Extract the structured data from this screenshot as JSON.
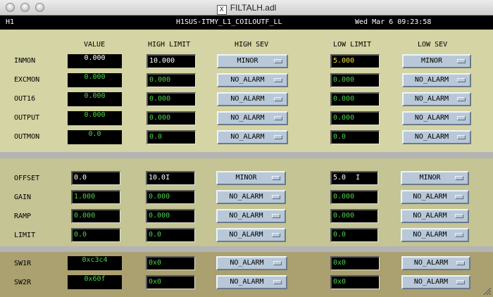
{
  "window": {
    "title": "FILTALH.adl",
    "x_icon": "X"
  },
  "header": {
    "site": "H1",
    "channel": "H1SUS-ITMY_L1_COILOUTF_LL",
    "datetime": "Wed Mar  6 09:23:58"
  },
  "columns": {
    "value": "VALUE",
    "high_limit": "HIGH LIMIT",
    "high_sev": "HIGH SEV",
    "low_limit": "LOW LIMIT",
    "low_sev": "LOW SEV"
  },
  "rows": {
    "inmon": {
      "label": "INMON",
      "value": "0.000",
      "high": "10.000",
      "high_sev": "MINOR",
      "low": "5.000",
      "low_sev": "MINOR"
    },
    "excmon": {
      "label": "EXCMON",
      "value": "0.000",
      "high": "0.000",
      "high_sev": "NO_ALARM",
      "low": "0.000",
      "low_sev": "NO_ALARM"
    },
    "out16": {
      "label": "OUT16",
      "value": "0.000",
      "high": "0.000",
      "high_sev": "NO_ALARM",
      "low": "0.000",
      "low_sev": "NO_ALARM"
    },
    "output": {
      "label": "OUTPUT",
      "value": "0.000",
      "high": "0.000",
      "high_sev": "NO_ALARM",
      "low": "0.000",
      "low_sev": "NO_ALARM"
    },
    "outmon": {
      "label": "OUTMON",
      "value": "0.0",
      "high": "0.0",
      "high_sev": "NO_ALARM",
      "low": "0.0",
      "low_sev": "NO_ALARM"
    },
    "offset": {
      "label": "OFFSET",
      "value": "0.0",
      "high": "10.0",
      "high_sev": "MINOR",
      "low": "5.0",
      "low_sev": "MINOR"
    },
    "gain": {
      "label": "GAIN",
      "value": "1.000",
      "high": "0.000",
      "high_sev": "NO_ALARM",
      "low": "0.000",
      "low_sev": "NO_ALARM"
    },
    "ramp": {
      "label": "RAMP",
      "value": "0.000",
      "high": "0.000",
      "high_sev": "NO_ALARM",
      "low": "0.000",
      "low_sev": "NO_ALARM"
    },
    "limit": {
      "label": "LIMIT",
      "value": "0.0",
      "high": "0.0",
      "high_sev": "NO_ALARM",
      "low": "0.0",
      "low_sev": "NO_ALARM"
    },
    "sw1r": {
      "label": "SW1R",
      "value": "0xc3c4",
      "high": "0x0",
      "high_sev": "NO_ALARM",
      "low": "0x0",
      "low_sev": "NO_ALARM"
    },
    "sw2r": {
      "label": "SW2R",
      "value": "0x60f",
      "high": "0x0",
      "high_sev": "NO_ALARM",
      "low": "0x0",
      "low_sev": "NO_ALARM"
    }
  },
  "colors": {
    "panel_top": "#d4d4a4",
    "panel_mid": "#c4c494",
    "panel_bottom": "#aaa070",
    "field_text": "#4cd24c",
    "alarm_text": "#f0e040",
    "menu_bg": "#b8c8d8"
  }
}
